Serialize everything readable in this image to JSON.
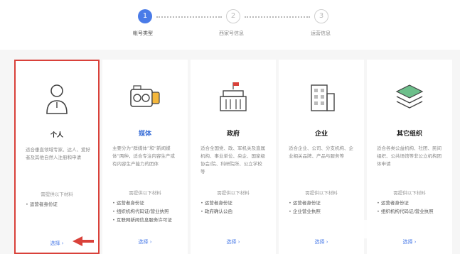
{
  "steps": [
    {
      "number": "1",
      "label": "帐号类型",
      "active": true
    },
    {
      "number": "2",
      "label": "西家号信息",
      "active": false
    },
    {
      "number": "3",
      "label": "运营信息",
      "active": false
    }
  ],
  "cards": [
    {
      "title": "个人",
      "icon": "person-icon",
      "description": "适合垂直领域专家、达人、爱好者及其他自然人注册和申请",
      "requirements_title": "需提供以下材料",
      "requirements": [
        "运营者身份证"
      ],
      "select_label": "选择 ›"
    },
    {
      "title": "媒体",
      "icon": "camera-icon",
      "description": "主要分为“群媒体”和“新闻媒体”两种，适合专注内容生产或有内容生产能力的团体",
      "requirements_title": "需提供以下材料",
      "requirements": [
        "运营者身份证",
        "组织机构代码证/营业执照",
        "互联网新闻信息服务许可证"
      ],
      "select_label": "选择 ›"
    },
    {
      "title": "政府",
      "icon": "government-building-icon",
      "description": "适合全国党、政、军机关及直属机构、事业单位、央企、国家级协会/院、科研院所、公立学校等",
      "requirements_title": "需提供以下材料",
      "requirements": [
        "运营者身份证",
        "政府确认公函"
      ],
      "select_label": "选择 ›"
    },
    {
      "title": "企业",
      "icon": "enterprise-building-icon",
      "description": "适合企业、公司、分支机构、企业相关品牌、产品与服务等",
      "requirements_title": "需提供以下材料",
      "requirements": [
        "运营者身份证",
        "企业营业执照"
      ],
      "select_label": "选择 ›"
    },
    {
      "title": "其它组织",
      "icon": "stack-layers-icon",
      "description": "适合各类公益机构、社团、民间组织、公共场馆等非公立机构团体申请",
      "requirements_title": "需提供以下材料",
      "requirements": [
        "运营者身份证",
        "组织机构代码证/营业执照"
      ],
      "select_label": "选择 ›"
    }
  ],
  "colors": {
    "accent": "#4a7be8",
    "selected_border": "#d9413a",
    "background": "#f6f6f6"
  }
}
